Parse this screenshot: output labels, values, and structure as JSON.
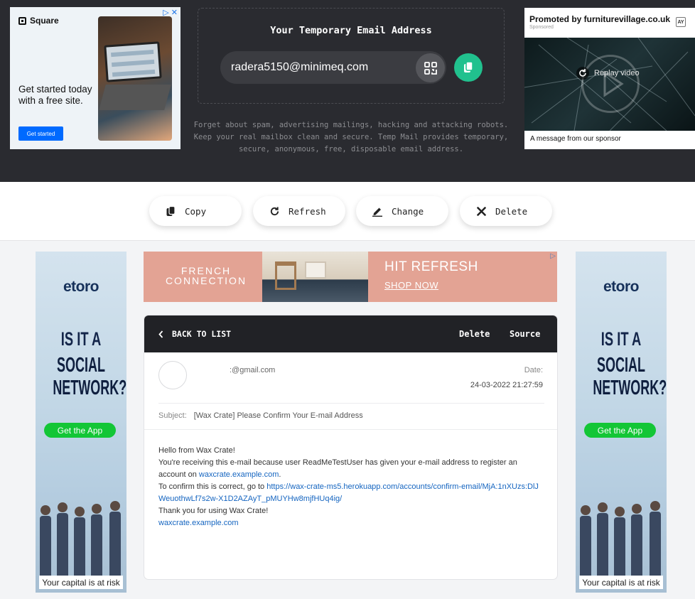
{
  "left_ad": {
    "brand": "Square",
    "headline": "Get started today with a free site.",
    "cta": "Get started",
    "adchoices": "▷ ✕"
  },
  "email_box": {
    "title": "Your Temporary Email Address",
    "address": "radera5150@minimeq.com",
    "tagline": "Forget about spam, advertising mailings, hacking and attacking robots. Keep your real mailbox clean and secure. Temp Mail provides temporary, secure, anonymous, free, disposable email address."
  },
  "right_ad": {
    "promoted": "Promoted by furniturevillage.co.uk",
    "sponsored": "Sponsored",
    "badge": "AY",
    "replay": "Replay video",
    "message": "A message from our sponsor"
  },
  "actions": {
    "copy": "Copy",
    "refresh": "Refresh",
    "change": "Change",
    "delete": "Delete"
  },
  "side_ad": {
    "brand": "etoro",
    "line1": "IS IT A",
    "line2": "SOCIAL NETWORK?",
    "cta": "Get the App",
    "risk": "Your capital is at risk"
  },
  "banner": {
    "brand": "FRENCH CONNECTION",
    "headline": "HIT REFRESH",
    "cta": "SHOP NOW"
  },
  "email": {
    "back_label": "BACK TO LIST",
    "delete_label": "Delete",
    "source_label": "Source",
    "from": ":@gmail.com",
    "date_label": "Date:",
    "date": "24-03-2022 21:27:59",
    "subject_label": "Subject:",
    "subject": "[Wax Crate] Please Confirm Your E-mail Address",
    "greeting": "Hello from Wax Crate!",
    "line1": "You're receiving this e-mail because user ReadMeTestUser has given your e-mail address to register an account on",
    "link1": "waxcrate.example.com",
    "line1_end": ".",
    "line2": "To confirm this is correct, go to",
    "link2": "https://wax-crate-ms5.herokuapp.com/accounts/confirm-email/MjA:1nXUzs:DlJWeuothwLf7s2w-X1D2AZAyT_pMUYHw8mjfHUq4ig/",
    "line3": "Thank you for using Wax Crate!",
    "link3": "waxcrate.example.com"
  },
  "colors": {
    "header_bg": "#2a2b30",
    "accent_green": "#21c18e",
    "link_blue": "#1565c0"
  }
}
